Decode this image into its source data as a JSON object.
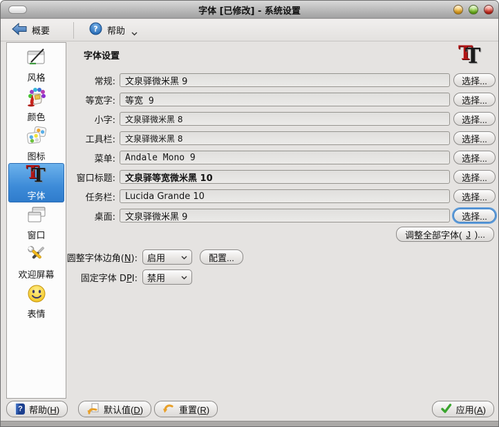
{
  "window": {
    "title": "字体 [已修改] - 系统设置",
    "control_colors": {
      "minimize": "#f0a513",
      "maximize": "#69b80e",
      "close": "#cf1d10"
    }
  },
  "toolbar": {
    "overview_label": "概要",
    "help_label": "帮助"
  },
  "sidebar": {
    "selected": "字体",
    "items": [
      {
        "label": "风格"
      },
      {
        "label": "颜色"
      },
      {
        "label": "图标"
      },
      {
        "label": "字体"
      },
      {
        "label": "窗口"
      },
      {
        "label": "欢迎屏幕"
      },
      {
        "label": "表情"
      }
    ]
  },
  "content": {
    "title": "字体设置",
    "rows": [
      {
        "label": "常规:",
        "value": "文泉驿微米黑 9",
        "button": "选择..."
      },
      {
        "label": "等宽字:",
        "value": "等宽 9",
        "button": "选择..."
      },
      {
        "label": "小字:",
        "value": "文泉驿微米黑 8",
        "button": "选择..."
      },
      {
        "label": "工具栏:",
        "value": "文泉驿微米黑 8",
        "button": "选择..."
      },
      {
        "label": "菜单:",
        "value": "Andale Mono 9",
        "button": "选择..."
      },
      {
        "label": "窗口标题:",
        "value": "文泉驿等宽微米黑 10",
        "button": "选择..."
      },
      {
        "label": "任务栏:",
        "value": "Lucida Grande 10",
        "button": "选择..."
      },
      {
        "label": "桌面:",
        "value": "文泉驿微米黑 9",
        "button": "选择..."
      }
    ],
    "adjust_all_label": "调整全部字体(_J)...",
    "antialias": {
      "label": "圆整字体边角(_N):",
      "value": "启用",
      "configure_label": "配置..."
    },
    "dpi": {
      "label": "固定字体 D_PI:",
      "value": "禁用"
    }
  },
  "footer": {
    "help_label": "帮助(_H)",
    "defaults_label": "默认值(_D)",
    "reset_label": "重置(_R)",
    "apply_label": "应用(_A)"
  },
  "icons": {
    "t_glyph": "T",
    "question_glyph": "?"
  },
  "colors": {
    "selection_blue": "#3d8bd8",
    "focus_ring": "#5d9bd9",
    "apply_check_green": "#3aa52e",
    "undo_arrow_orange": "#e8a02a"
  }
}
